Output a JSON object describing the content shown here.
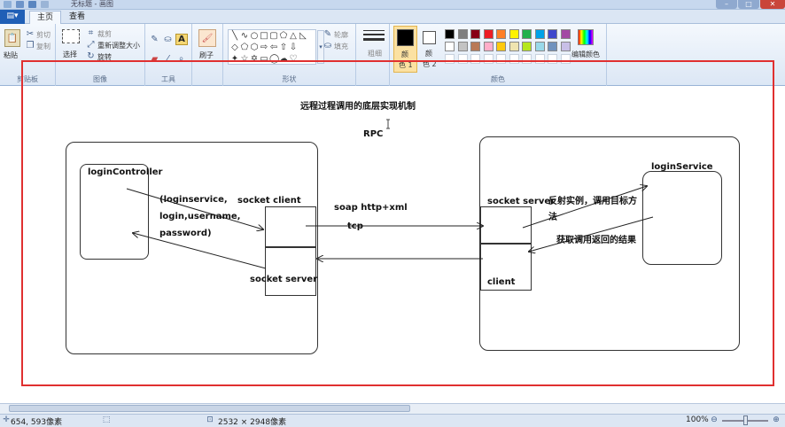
{
  "window": {
    "title": "无标题 - 画图"
  },
  "tabs": {
    "home": "主页",
    "view": "查看"
  },
  "clipboard": {
    "paste": "粘贴",
    "cut": "剪切",
    "copy": "复制",
    "group": "剪贴板"
  },
  "image": {
    "select": "选择",
    "crop": "裁剪",
    "resize": "重新调整大小",
    "rotate": "旋转",
    "group": "图像"
  },
  "tools": {
    "group": "工具"
  },
  "brush": {
    "label": "刷子"
  },
  "shapes": {
    "outline": "轮廓",
    "fill": "填充",
    "group": "形状"
  },
  "size": {
    "label": "粗细"
  },
  "colors": {
    "color1_a": "颜",
    "color1_b": "色 1",
    "color2_a": "颜",
    "color2_b": "色 2",
    "edit": "编辑颜色",
    "group": "颜色",
    "palette_row1": [
      "#000000",
      "#7f7f7f",
      "#880015",
      "#ed1c24",
      "#ff7f27",
      "#fff200",
      "#22b14c",
      "#00a2e8",
      "#3f48cc",
      "#a349a4"
    ],
    "palette_row2": [
      "#ffffff",
      "#c3c3c3",
      "#b97a57",
      "#ffaec9",
      "#ffc90e",
      "#efe4b0",
      "#b5e61d",
      "#99d9ea",
      "#7092be",
      "#c8bfe7"
    ],
    "color1": "#000000",
    "color2": "#ffffff"
  },
  "diagram": {
    "title": "远程过程调用的底层实现机制",
    "rpc": "RPC",
    "login_controller": "loginController",
    "params1": "(loginservice,",
    "params2": "login,username,",
    "params3": "password)",
    "socket_client": "socket client",
    "socket_server_left": "socket server",
    "soap": "soap  http+xml",
    "tcp": "tcp",
    "socket_server_right": "socket server",
    "client": "client",
    "reflect1": "反射实例，调用目标方",
    "reflect2": "法",
    "result": "获取调用返回的结果",
    "login_service": "loginService"
  },
  "status": {
    "cursor": "654, 593像素",
    "dimensions": "2532 × 2948像素",
    "zoom": "100%"
  }
}
